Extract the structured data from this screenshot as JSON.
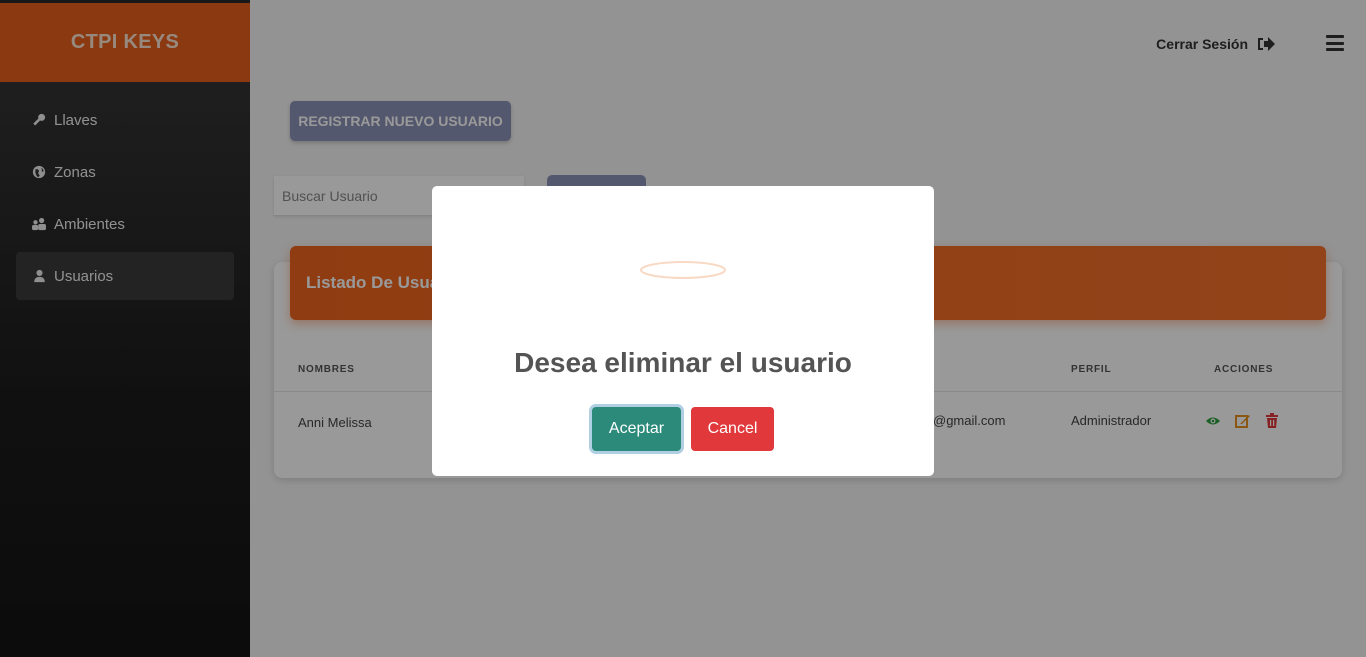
{
  "brand": {
    "title": "CTPI KEYS"
  },
  "sidebar": {
    "items": [
      {
        "label": "Llaves",
        "icon": "key-icon"
      },
      {
        "label": "Zonas",
        "icon": "globe-icon"
      },
      {
        "label": "Ambientes",
        "icon": "people-icon"
      },
      {
        "label": "Usuarios",
        "icon": "user-icon",
        "active": true
      }
    ]
  },
  "header": {
    "logout_label": "Cerrar Sesión"
  },
  "toolbar": {
    "register_label": "REGISTRAR NUEVO USUARIO",
    "search_placeholder": "Buscar Usuario"
  },
  "card": {
    "title": "Listado De Usuarios"
  },
  "table": {
    "columns": [
      "NOMBRES",
      "PERFIL",
      "ACCIONES"
    ],
    "rows": [
      {
        "nombres": "Anni Melissa",
        "email": "@gmail.com",
        "perfil": "Administrador"
      }
    ]
  },
  "modal": {
    "title": "Desea eliminar el usuario",
    "confirm_label": "Aceptar",
    "cancel_label": "Cancel"
  },
  "colors": {
    "accent": "#e8601c",
    "register_button": "#8d93b7",
    "confirm": "#2b8a7a",
    "cancel": "#e1383b"
  }
}
